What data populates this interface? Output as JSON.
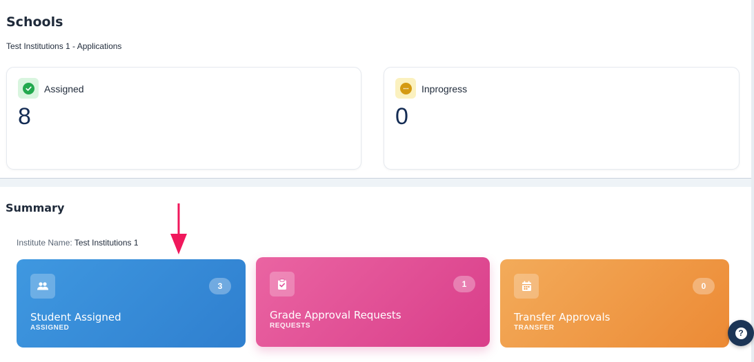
{
  "schools": {
    "title": "Schools",
    "subtitle": "Test Institutions 1 - Applications",
    "stats": [
      {
        "label": "Assigned",
        "value": "8",
        "icon": "check-circle-icon",
        "color": "#23a94e"
      },
      {
        "label": "Inprogress",
        "value": "0",
        "icon": "more-horizontal-icon",
        "color": "#d49a12"
      }
    ]
  },
  "summary": {
    "title": "Summary",
    "institute_label": "Institute Name:",
    "institute_value": "Test Institutions 1",
    "cards": [
      {
        "title": "Student Assigned",
        "subtitle": "ASSIGNED",
        "count": "3",
        "icon": "users-icon",
        "color": "#3a8fdc"
      },
      {
        "title": "Grade Approval Requests",
        "subtitle": "REQUESTS",
        "count": "1",
        "icon": "clipboard-check-icon",
        "color": "#e2509a"
      },
      {
        "title": "Transfer Approvals",
        "subtitle": "TRANSFER",
        "count": "0",
        "icon": "calendar-icon",
        "color": "#f09a45"
      }
    ]
  },
  "help": {
    "icon": "question-icon",
    "glyph": "?"
  }
}
